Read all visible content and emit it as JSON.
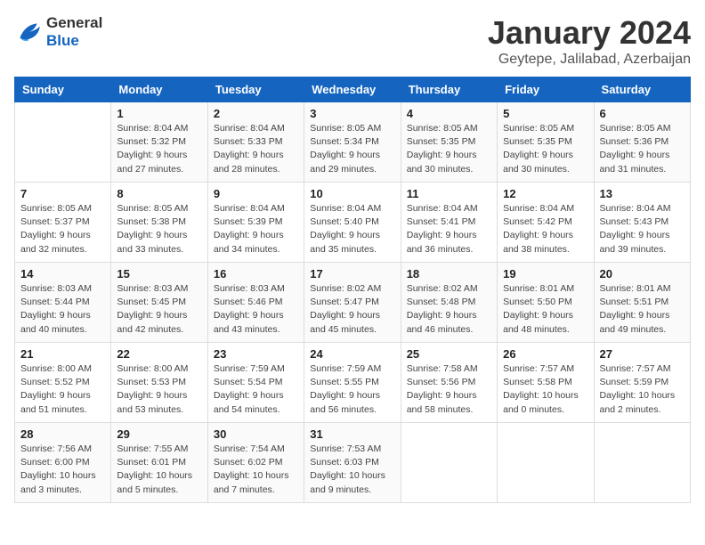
{
  "logo": {
    "text_general": "General",
    "text_blue": "Blue"
  },
  "title": "January 2024",
  "subtitle": "Geytepe, Jalilabad, Azerbaijan",
  "days_header": [
    "Sunday",
    "Monday",
    "Tuesday",
    "Wednesday",
    "Thursday",
    "Friday",
    "Saturday"
  ],
  "weeks": [
    [
      {
        "num": "",
        "info": ""
      },
      {
        "num": "1",
        "info": "Sunrise: 8:04 AM\nSunset: 5:32 PM\nDaylight: 9 hours\nand 27 minutes."
      },
      {
        "num": "2",
        "info": "Sunrise: 8:04 AM\nSunset: 5:33 PM\nDaylight: 9 hours\nand 28 minutes."
      },
      {
        "num": "3",
        "info": "Sunrise: 8:05 AM\nSunset: 5:34 PM\nDaylight: 9 hours\nand 29 minutes."
      },
      {
        "num": "4",
        "info": "Sunrise: 8:05 AM\nSunset: 5:35 PM\nDaylight: 9 hours\nand 30 minutes."
      },
      {
        "num": "5",
        "info": "Sunrise: 8:05 AM\nSunset: 5:35 PM\nDaylight: 9 hours\nand 30 minutes."
      },
      {
        "num": "6",
        "info": "Sunrise: 8:05 AM\nSunset: 5:36 PM\nDaylight: 9 hours\nand 31 minutes."
      }
    ],
    [
      {
        "num": "7",
        "info": "Sunrise: 8:05 AM\nSunset: 5:37 PM\nDaylight: 9 hours\nand 32 minutes."
      },
      {
        "num": "8",
        "info": "Sunrise: 8:05 AM\nSunset: 5:38 PM\nDaylight: 9 hours\nand 33 minutes."
      },
      {
        "num": "9",
        "info": "Sunrise: 8:04 AM\nSunset: 5:39 PM\nDaylight: 9 hours\nand 34 minutes."
      },
      {
        "num": "10",
        "info": "Sunrise: 8:04 AM\nSunset: 5:40 PM\nDaylight: 9 hours\nand 35 minutes."
      },
      {
        "num": "11",
        "info": "Sunrise: 8:04 AM\nSunset: 5:41 PM\nDaylight: 9 hours\nand 36 minutes."
      },
      {
        "num": "12",
        "info": "Sunrise: 8:04 AM\nSunset: 5:42 PM\nDaylight: 9 hours\nand 38 minutes."
      },
      {
        "num": "13",
        "info": "Sunrise: 8:04 AM\nSunset: 5:43 PM\nDaylight: 9 hours\nand 39 minutes."
      }
    ],
    [
      {
        "num": "14",
        "info": "Sunrise: 8:03 AM\nSunset: 5:44 PM\nDaylight: 9 hours\nand 40 minutes."
      },
      {
        "num": "15",
        "info": "Sunrise: 8:03 AM\nSunset: 5:45 PM\nDaylight: 9 hours\nand 42 minutes."
      },
      {
        "num": "16",
        "info": "Sunrise: 8:03 AM\nSunset: 5:46 PM\nDaylight: 9 hours\nand 43 minutes."
      },
      {
        "num": "17",
        "info": "Sunrise: 8:02 AM\nSunset: 5:47 PM\nDaylight: 9 hours\nand 45 minutes."
      },
      {
        "num": "18",
        "info": "Sunrise: 8:02 AM\nSunset: 5:48 PM\nDaylight: 9 hours\nand 46 minutes."
      },
      {
        "num": "19",
        "info": "Sunrise: 8:01 AM\nSunset: 5:50 PM\nDaylight: 9 hours\nand 48 minutes."
      },
      {
        "num": "20",
        "info": "Sunrise: 8:01 AM\nSunset: 5:51 PM\nDaylight: 9 hours\nand 49 minutes."
      }
    ],
    [
      {
        "num": "21",
        "info": "Sunrise: 8:00 AM\nSunset: 5:52 PM\nDaylight: 9 hours\nand 51 minutes."
      },
      {
        "num": "22",
        "info": "Sunrise: 8:00 AM\nSunset: 5:53 PM\nDaylight: 9 hours\nand 53 minutes."
      },
      {
        "num": "23",
        "info": "Sunrise: 7:59 AM\nSunset: 5:54 PM\nDaylight: 9 hours\nand 54 minutes."
      },
      {
        "num": "24",
        "info": "Sunrise: 7:59 AM\nSunset: 5:55 PM\nDaylight: 9 hours\nand 56 minutes."
      },
      {
        "num": "25",
        "info": "Sunrise: 7:58 AM\nSunset: 5:56 PM\nDaylight: 9 hours\nand 58 minutes."
      },
      {
        "num": "26",
        "info": "Sunrise: 7:57 AM\nSunset: 5:58 PM\nDaylight: 10 hours\nand 0 minutes."
      },
      {
        "num": "27",
        "info": "Sunrise: 7:57 AM\nSunset: 5:59 PM\nDaylight: 10 hours\nand 2 minutes."
      }
    ],
    [
      {
        "num": "28",
        "info": "Sunrise: 7:56 AM\nSunset: 6:00 PM\nDaylight: 10 hours\nand 3 minutes."
      },
      {
        "num": "29",
        "info": "Sunrise: 7:55 AM\nSunset: 6:01 PM\nDaylight: 10 hours\nand 5 minutes."
      },
      {
        "num": "30",
        "info": "Sunrise: 7:54 AM\nSunset: 6:02 PM\nDaylight: 10 hours\nand 7 minutes."
      },
      {
        "num": "31",
        "info": "Sunrise: 7:53 AM\nSunset: 6:03 PM\nDaylight: 10 hours\nand 9 minutes."
      },
      {
        "num": "",
        "info": ""
      },
      {
        "num": "",
        "info": ""
      },
      {
        "num": "",
        "info": ""
      }
    ]
  ]
}
